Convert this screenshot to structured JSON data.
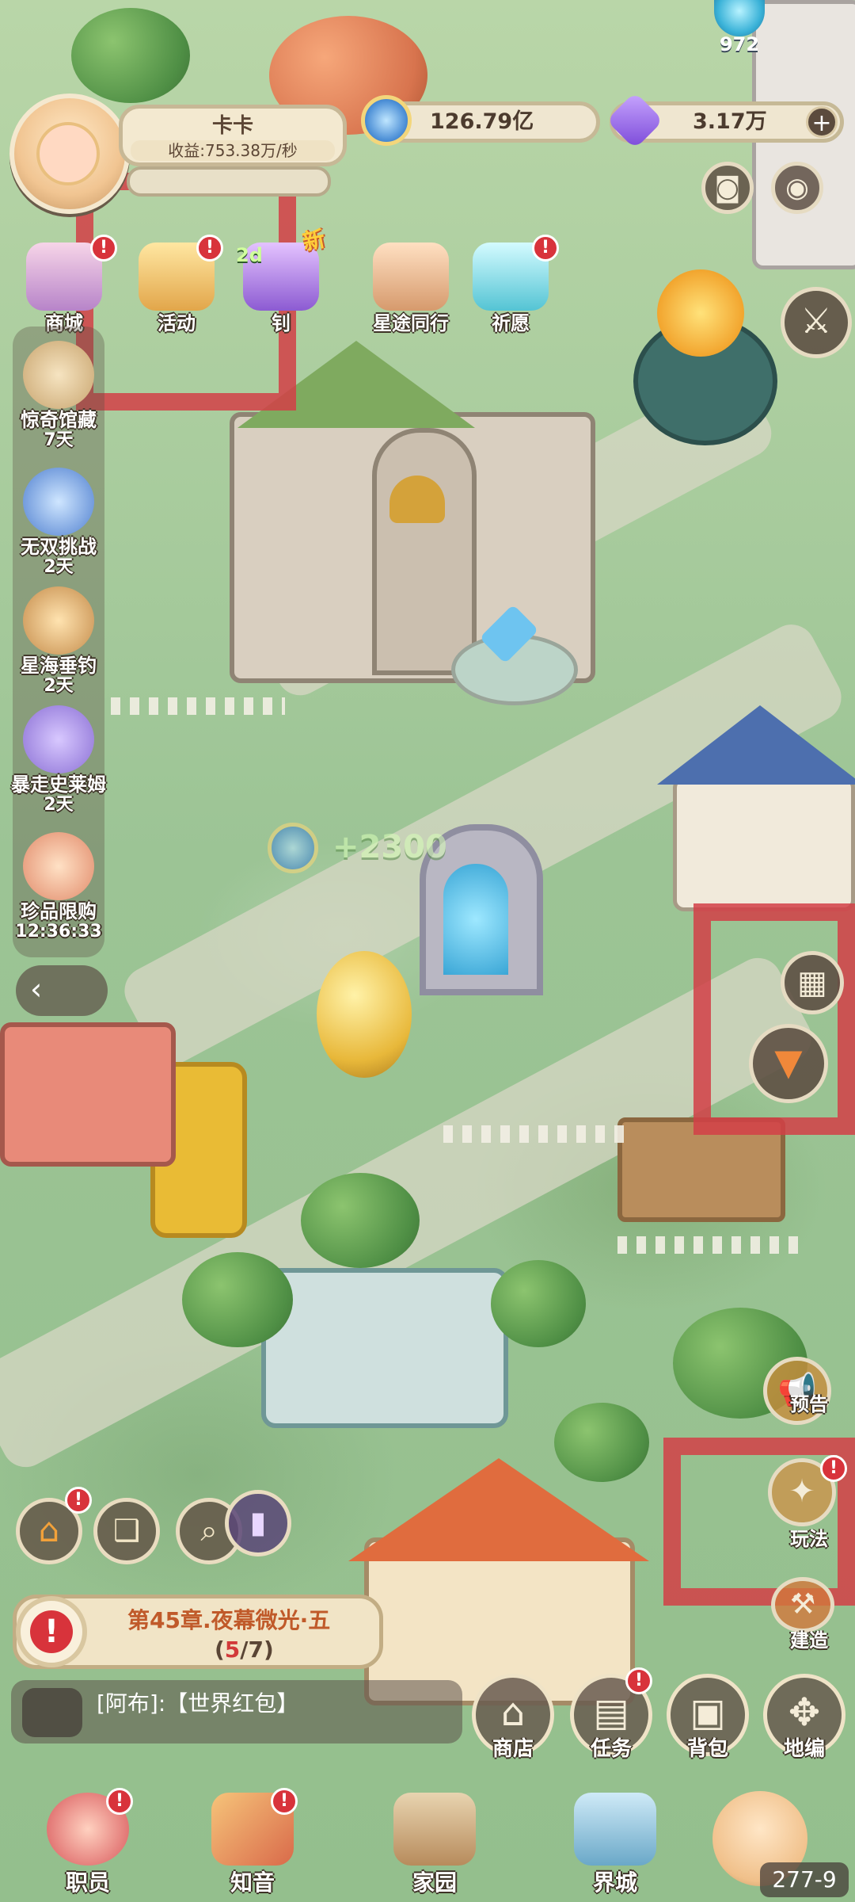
{
  "player": {
    "name": "卡卡",
    "income": "收益:753.38万/秒",
    "subtitle": ""
  },
  "resources": {
    "orb_count": "972",
    "coins": "126.79亿",
    "gems": "3.17万"
  },
  "top_features": [
    {
      "label": "商城",
      "icon": "shop-icon"
    },
    {
      "label": "活动",
      "icon": "event-icon"
    },
    {
      "label": "钊",
      "icon": "potion-icon"
    },
    {
      "label": "星途同行",
      "icon": "companion-icon"
    },
    {
      "label": "祈愿",
      "icon": "wish-star-icon"
    }
  ],
  "tags": {
    "new": "新",
    "days": "2d"
  },
  "side_events": [
    {
      "label": "惊奇馆藏",
      "time": "7天"
    },
    {
      "label": "无双挑战",
      "time": "2天"
    },
    {
      "label": "星海垂钓",
      "time": "2天"
    },
    {
      "label": "暴走史莱姆",
      "time": "2天"
    },
    {
      "label": "珍品限购",
      "time": "12:36:33"
    }
  ],
  "floating_reward": "+2300",
  "right_buttons": [
    {
      "label": "预告"
    },
    {
      "label": "玩法"
    },
    {
      "label": "建造"
    }
  ],
  "chapter": {
    "title": "第45章.夜幕微光·五",
    "progress_open": "(",
    "progress_current": "5",
    "progress_total": "/7)"
  },
  "chat": {
    "message": "[阿布]:【世界红包】"
  },
  "actions": [
    {
      "label": "商店"
    },
    {
      "label": "任务"
    },
    {
      "label": "背包"
    },
    {
      "label": "地编"
    }
  ],
  "bottom_nav": [
    {
      "label": "职员"
    },
    {
      "label": "知音"
    },
    {
      "label": "家园"
    },
    {
      "label": "界城"
    }
  ],
  "build_number": "277-9",
  "colors": {
    "alert": "#d8333b",
    "highlight_box": "#d24046",
    "panel": "#f1e4c6",
    "text_dark": "#5a4535"
  }
}
